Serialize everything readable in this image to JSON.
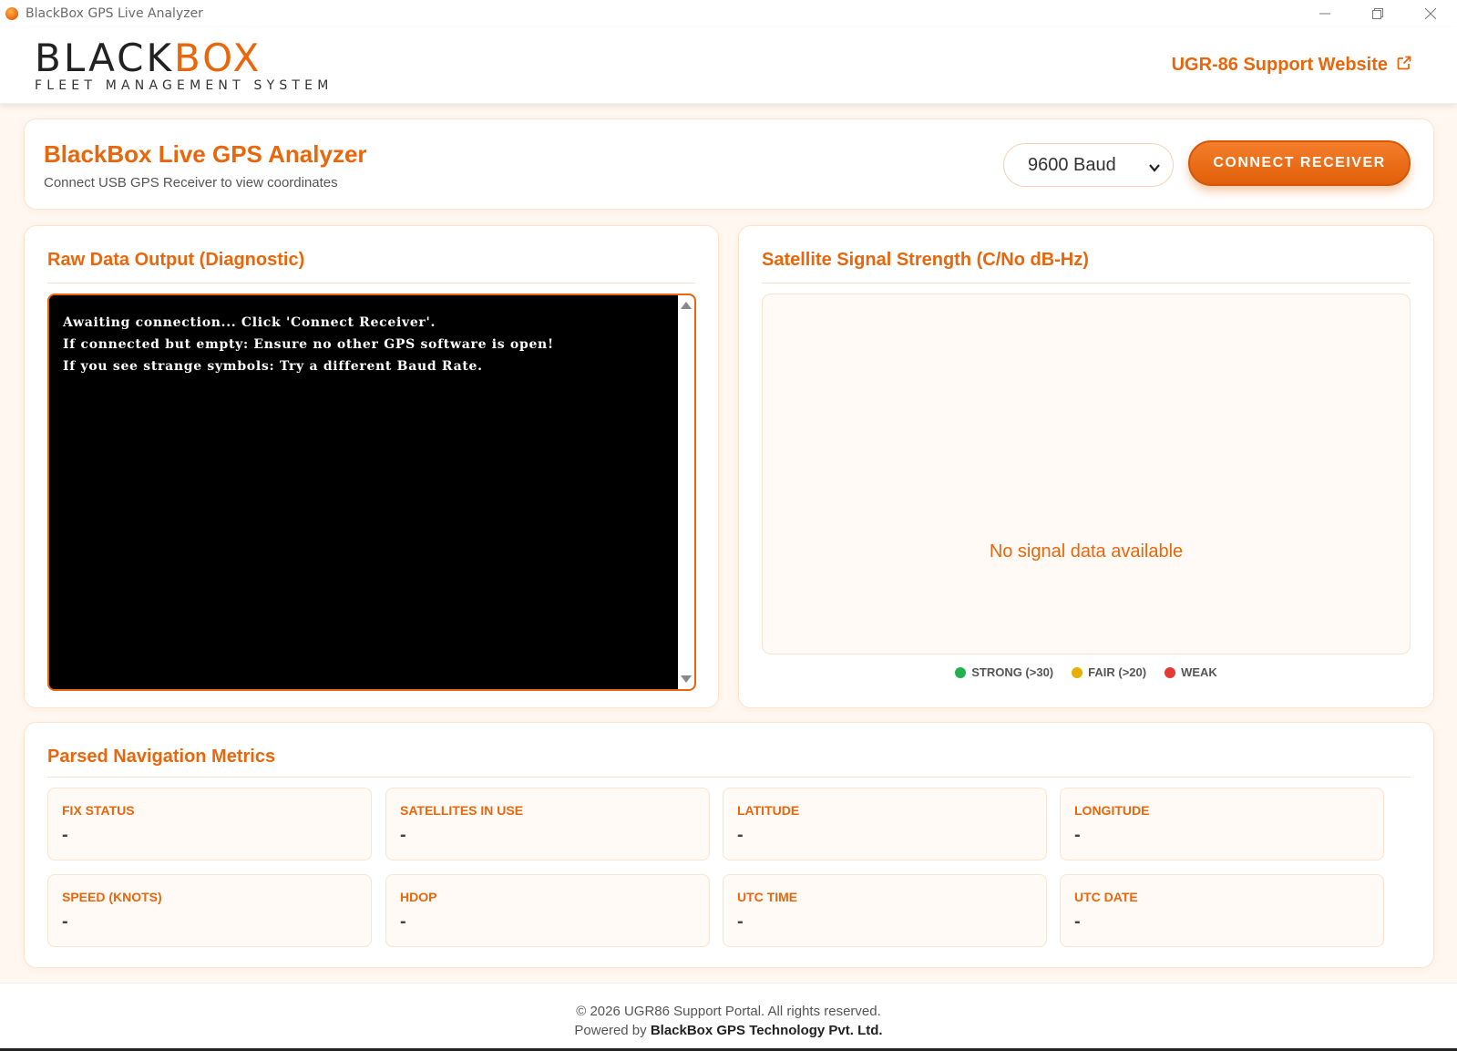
{
  "window": {
    "title": "BlackBox GPS Live Analyzer",
    "icons": [
      "minimize-icon",
      "maximize-icon",
      "close-icon"
    ]
  },
  "header": {
    "logo_black": "BLACK",
    "logo_orange": "BOX",
    "logo_sub": "FLEET MANAGEMENT SYSTEM",
    "support_link": "UGR-86 Support Website",
    "support_icon": "external-link-icon"
  },
  "controls": {
    "title": "BlackBox Live GPS Analyzer",
    "subtitle": "Connect USB GPS Receiver to view coordinates",
    "baud_value": "9600 Baud",
    "connect_label": "CONNECT RECEIVER"
  },
  "raw_output": {
    "title": "Raw Data Output (Diagnostic)",
    "lines": [
      "Awaiting connection... Click 'Connect Receiver'.",
      "If connected but empty: Ensure no other GPS software is open!",
      "If you see strange symbols: Try a different Baud Rate."
    ]
  },
  "satellite": {
    "title": "Satellite Signal Strength (C/No dB-Hz)",
    "empty_text": "No signal data available",
    "legend": [
      {
        "label": "STRONG (>30)",
        "color": "#22b14c"
      },
      {
        "label": "FAIR (>20)",
        "color": "#e6b000"
      },
      {
        "label": "WEAK",
        "color": "#e53935"
      }
    ]
  },
  "metrics": {
    "title": "Parsed Navigation Metrics",
    "items": [
      {
        "label": "FIX STATUS",
        "value": "-"
      },
      {
        "label": "SATELLITES IN USE",
        "value": "-"
      },
      {
        "label": "LATITUDE",
        "value": "-"
      },
      {
        "label": "LONGITUDE",
        "value": "-"
      },
      {
        "label": "SPEED (KNOTS)",
        "value": "-"
      },
      {
        "label": "HDOP",
        "value": "-"
      },
      {
        "label": "UTC TIME",
        "value": "-"
      },
      {
        "label": "UTC DATE",
        "value": "-"
      }
    ]
  },
  "footer": {
    "copyright": "© 2026 UGR86 Support Portal. All rights reserved.",
    "powered_prefix": "Powered by",
    "company": "BlackBox GPS Technology Pvt. Ltd."
  },
  "colors": {
    "accent": "#e8660c",
    "terminal_bg": "#000000"
  }
}
